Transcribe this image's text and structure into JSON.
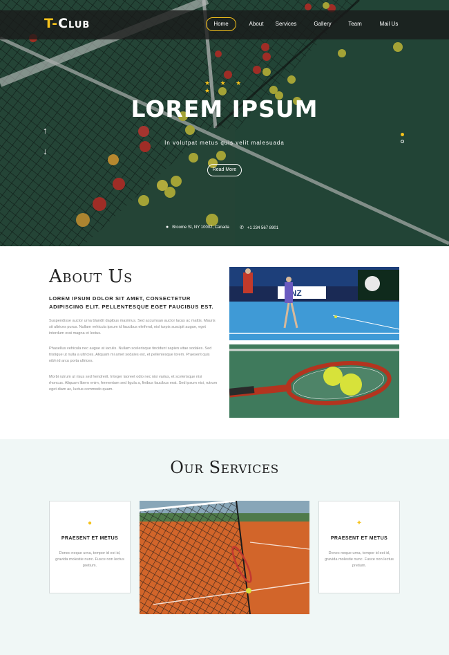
{
  "header": {
    "logo_initial": "T-",
    "logo_rest": "Club",
    "nav": [
      "Home",
      "About",
      "Services",
      "Gallery",
      "Team",
      "Mail Us"
    ],
    "active_nav": "Home"
  },
  "hero": {
    "rating_stars": "★ ★ ★ ★",
    "title": "LOREM IPSUM",
    "subtitle": "In volutpat metus quis velit malesuada",
    "button_label": "Read More",
    "arrow_up": "↑",
    "arrow_down": "↓",
    "address": "Broome St, NY 10002, Canada",
    "phone": "+1 234 567 8901",
    "location_icon": "location-pin-icon",
    "phone_icon": "phone-icon"
  },
  "about": {
    "title": "About Us",
    "lead": "LOREM IPSUM DOLOR SIT AMET, CONSECTETUR ADIPISCING ELIT. PELLENTESQUE EGET FAUCIBUS EST.",
    "paragraphs": [
      "Suspendisse auctor urna blandit dapibus maximus. Sed accumsan auctor lacus ac mattis. Mauris sit ultrices purus. Nullam vehicula ipsum id faucibus eleifend, nisl turpis suscipit augue, eget interdum erat magna et lectus.",
      "Phasellus vehicula nec augue at iaculis. Nullam scelerisque tincidunt sapien vitae sodales. Sed tristique ut nulla a ultricies. Aliquam mi amet sodales est, et pellentesque lorem. Praesent quis nibh id arcu porta ultrices.",
      "Morbi rutrum ut risus sed hendrerit. Integer laoreet odio nec nisi varius, et scelerisque nisi rhoncus. Aliquam libero enim, fermentum sed ligula a, finibus faucibus erat. Sed ipsum nisi, rutrum eget diam ac, luctus commodo quam."
    ]
  },
  "services": {
    "title": "Our Services",
    "cards": [
      {
        "title": "PRAESENT ET METUS",
        "text": "Donec neque urna, tempor id est id, gravida molestie nunc. Fusce non lectus pretium.",
        "icon": "user-icon"
      },
      {
        "title": "PRAESENT ET METUS",
        "text": "Donec neque urna, tempor id est id, gravida molestie nunc. Fusce non lectus pretium.",
        "icon": "trophy-icon"
      }
    ]
  },
  "colors": {
    "accent": "#f6c21b",
    "court_green": "#2f5a44",
    "services_bg": "#f0f7f6"
  }
}
